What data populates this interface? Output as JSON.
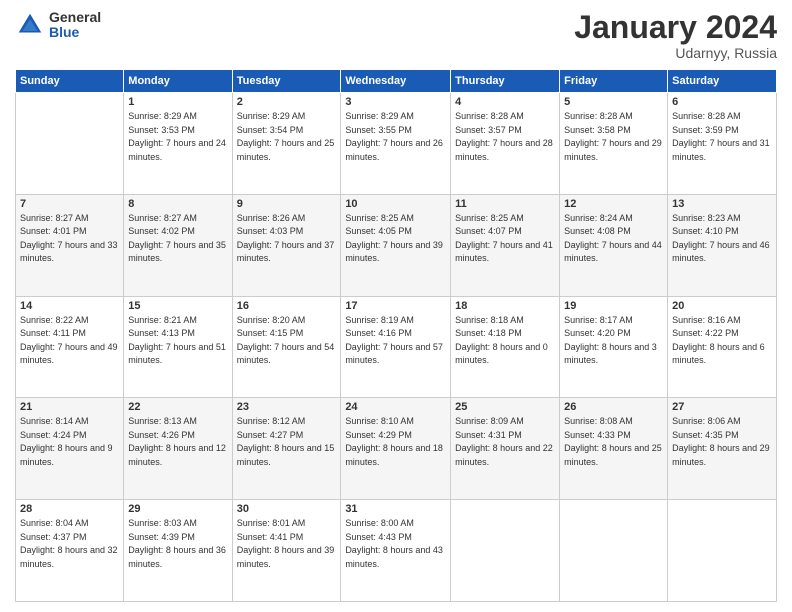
{
  "logo": {
    "general": "General",
    "blue": "Blue"
  },
  "header": {
    "month": "January 2024",
    "location": "Udarnyy, Russia"
  },
  "weekdays": [
    "Sunday",
    "Monday",
    "Tuesday",
    "Wednesday",
    "Thursday",
    "Friday",
    "Saturday"
  ],
  "weeks": [
    [
      {
        "day": "",
        "sunrise": "",
        "sunset": "",
        "daylight": ""
      },
      {
        "day": "1",
        "sunrise": "Sunrise: 8:29 AM",
        "sunset": "Sunset: 3:53 PM",
        "daylight": "Daylight: 7 hours and 24 minutes."
      },
      {
        "day": "2",
        "sunrise": "Sunrise: 8:29 AM",
        "sunset": "Sunset: 3:54 PM",
        "daylight": "Daylight: 7 hours and 25 minutes."
      },
      {
        "day": "3",
        "sunrise": "Sunrise: 8:29 AM",
        "sunset": "Sunset: 3:55 PM",
        "daylight": "Daylight: 7 hours and 26 minutes."
      },
      {
        "day": "4",
        "sunrise": "Sunrise: 8:28 AM",
        "sunset": "Sunset: 3:57 PM",
        "daylight": "Daylight: 7 hours and 28 minutes."
      },
      {
        "day": "5",
        "sunrise": "Sunrise: 8:28 AM",
        "sunset": "Sunset: 3:58 PM",
        "daylight": "Daylight: 7 hours and 29 minutes."
      },
      {
        "day": "6",
        "sunrise": "Sunrise: 8:28 AM",
        "sunset": "Sunset: 3:59 PM",
        "daylight": "Daylight: 7 hours and 31 minutes."
      }
    ],
    [
      {
        "day": "7",
        "sunrise": "Sunrise: 8:27 AM",
        "sunset": "Sunset: 4:01 PM",
        "daylight": "Daylight: 7 hours and 33 minutes."
      },
      {
        "day": "8",
        "sunrise": "Sunrise: 8:27 AM",
        "sunset": "Sunset: 4:02 PM",
        "daylight": "Daylight: 7 hours and 35 minutes."
      },
      {
        "day": "9",
        "sunrise": "Sunrise: 8:26 AM",
        "sunset": "Sunset: 4:03 PM",
        "daylight": "Daylight: 7 hours and 37 minutes."
      },
      {
        "day": "10",
        "sunrise": "Sunrise: 8:25 AM",
        "sunset": "Sunset: 4:05 PM",
        "daylight": "Daylight: 7 hours and 39 minutes."
      },
      {
        "day": "11",
        "sunrise": "Sunrise: 8:25 AM",
        "sunset": "Sunset: 4:07 PM",
        "daylight": "Daylight: 7 hours and 41 minutes."
      },
      {
        "day": "12",
        "sunrise": "Sunrise: 8:24 AM",
        "sunset": "Sunset: 4:08 PM",
        "daylight": "Daylight: 7 hours and 44 minutes."
      },
      {
        "day": "13",
        "sunrise": "Sunrise: 8:23 AM",
        "sunset": "Sunset: 4:10 PM",
        "daylight": "Daylight: 7 hours and 46 minutes."
      }
    ],
    [
      {
        "day": "14",
        "sunrise": "Sunrise: 8:22 AM",
        "sunset": "Sunset: 4:11 PM",
        "daylight": "Daylight: 7 hours and 49 minutes."
      },
      {
        "day": "15",
        "sunrise": "Sunrise: 8:21 AM",
        "sunset": "Sunset: 4:13 PM",
        "daylight": "Daylight: 7 hours and 51 minutes."
      },
      {
        "day": "16",
        "sunrise": "Sunrise: 8:20 AM",
        "sunset": "Sunset: 4:15 PM",
        "daylight": "Daylight: 7 hours and 54 minutes."
      },
      {
        "day": "17",
        "sunrise": "Sunrise: 8:19 AM",
        "sunset": "Sunset: 4:16 PM",
        "daylight": "Daylight: 7 hours and 57 minutes."
      },
      {
        "day": "18",
        "sunrise": "Sunrise: 8:18 AM",
        "sunset": "Sunset: 4:18 PM",
        "daylight": "Daylight: 8 hours and 0 minutes."
      },
      {
        "day": "19",
        "sunrise": "Sunrise: 8:17 AM",
        "sunset": "Sunset: 4:20 PM",
        "daylight": "Daylight: 8 hours and 3 minutes."
      },
      {
        "day": "20",
        "sunrise": "Sunrise: 8:16 AM",
        "sunset": "Sunset: 4:22 PM",
        "daylight": "Daylight: 8 hours and 6 minutes."
      }
    ],
    [
      {
        "day": "21",
        "sunrise": "Sunrise: 8:14 AM",
        "sunset": "Sunset: 4:24 PM",
        "daylight": "Daylight: 8 hours and 9 minutes."
      },
      {
        "day": "22",
        "sunrise": "Sunrise: 8:13 AM",
        "sunset": "Sunset: 4:26 PM",
        "daylight": "Daylight: 8 hours and 12 minutes."
      },
      {
        "day": "23",
        "sunrise": "Sunrise: 8:12 AM",
        "sunset": "Sunset: 4:27 PM",
        "daylight": "Daylight: 8 hours and 15 minutes."
      },
      {
        "day": "24",
        "sunrise": "Sunrise: 8:10 AM",
        "sunset": "Sunset: 4:29 PM",
        "daylight": "Daylight: 8 hours and 18 minutes."
      },
      {
        "day": "25",
        "sunrise": "Sunrise: 8:09 AM",
        "sunset": "Sunset: 4:31 PM",
        "daylight": "Daylight: 8 hours and 22 minutes."
      },
      {
        "day": "26",
        "sunrise": "Sunrise: 8:08 AM",
        "sunset": "Sunset: 4:33 PM",
        "daylight": "Daylight: 8 hours and 25 minutes."
      },
      {
        "day": "27",
        "sunrise": "Sunrise: 8:06 AM",
        "sunset": "Sunset: 4:35 PM",
        "daylight": "Daylight: 8 hours and 29 minutes."
      }
    ],
    [
      {
        "day": "28",
        "sunrise": "Sunrise: 8:04 AM",
        "sunset": "Sunset: 4:37 PM",
        "daylight": "Daylight: 8 hours and 32 minutes."
      },
      {
        "day": "29",
        "sunrise": "Sunrise: 8:03 AM",
        "sunset": "Sunset: 4:39 PM",
        "daylight": "Daylight: 8 hours and 36 minutes."
      },
      {
        "day": "30",
        "sunrise": "Sunrise: 8:01 AM",
        "sunset": "Sunset: 4:41 PM",
        "daylight": "Daylight: 8 hours and 39 minutes."
      },
      {
        "day": "31",
        "sunrise": "Sunrise: 8:00 AM",
        "sunset": "Sunset: 4:43 PM",
        "daylight": "Daylight: 8 hours and 43 minutes."
      },
      {
        "day": "",
        "sunrise": "",
        "sunset": "",
        "daylight": ""
      },
      {
        "day": "",
        "sunrise": "",
        "sunset": "",
        "daylight": ""
      },
      {
        "day": "",
        "sunrise": "",
        "sunset": "",
        "daylight": ""
      }
    ]
  ]
}
